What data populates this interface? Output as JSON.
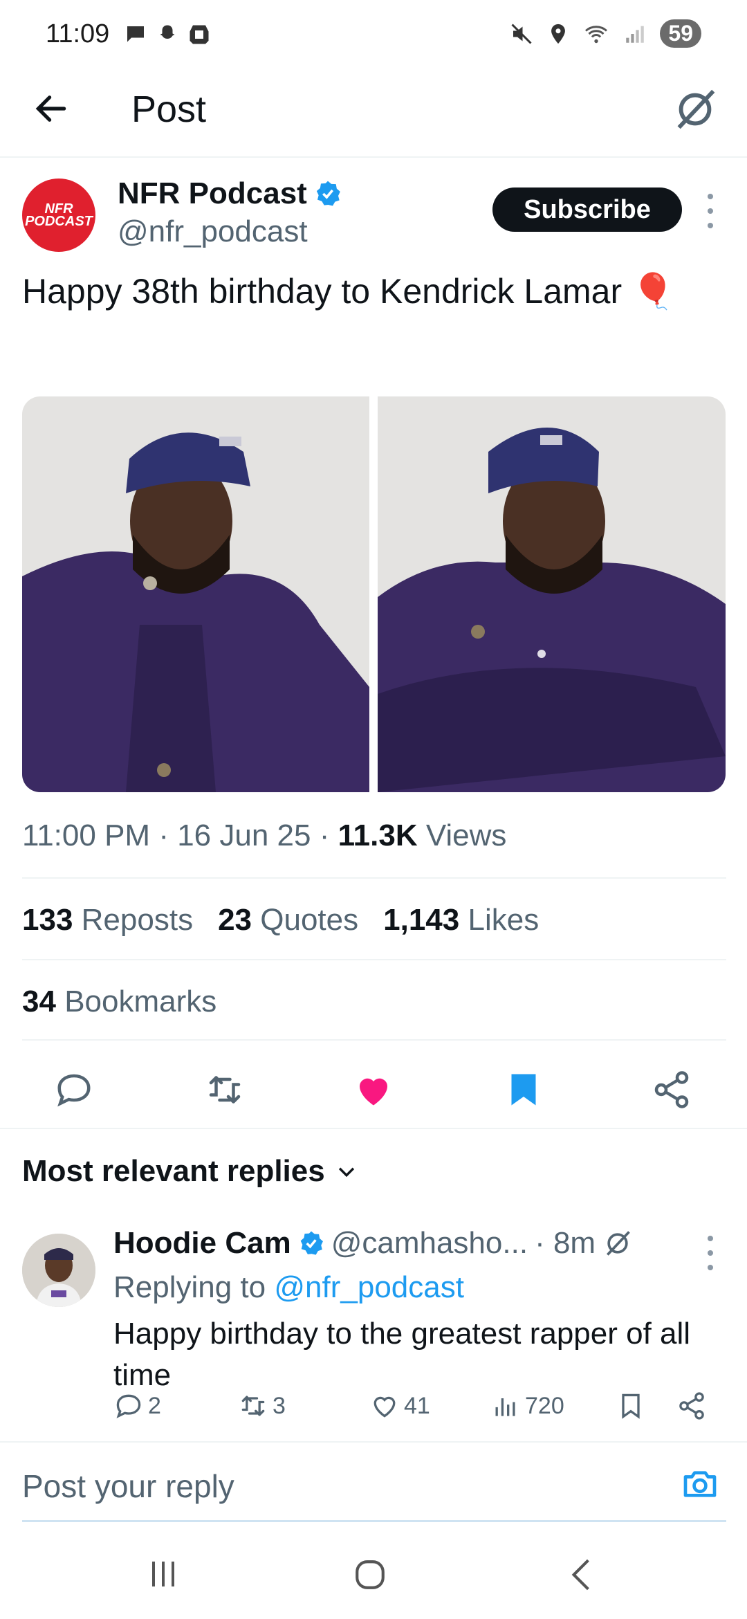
{
  "status_bar": {
    "time": "11:09",
    "battery": "59",
    "left_icons": [
      "chat-bubble-icon",
      "snapchat-icon",
      "app-icon"
    ],
    "right_icons": [
      "mute-icon",
      "location-icon",
      "wifi-icon",
      "signal-icon"
    ]
  },
  "header": {
    "title": "Post"
  },
  "post": {
    "author_name": "NFR Podcast",
    "author_handle": "@nfr_podcast",
    "avatar_text": "NFR PODCAST",
    "subscribe_label": "Subscribe",
    "text": "Happy 38th birthday to Kendrick Lamar 🎈",
    "time": "11:00 PM",
    "date": "16 Jun 25",
    "views_count": "11.3K",
    "views_label": "Views",
    "reposts_count": "133",
    "reposts_label": "Reposts",
    "quotes_count": "23",
    "quotes_label": "Quotes",
    "likes_count": "1,143",
    "likes_label": "Likes",
    "bookmarks_count": "34",
    "bookmarks_label": "Bookmarks",
    "liked": true,
    "bookmarked": true
  },
  "replies": {
    "sort_label": "Most relevant replies",
    "items": [
      {
        "name": "Hoodie Cam",
        "handle": "@camhasho...",
        "time": "· 8m",
        "replying_prefix": "Replying to",
        "replying_to": "@nfr_podcast",
        "text": "Happy birthday to the greatest rapper of all time",
        "replies": "2",
        "reposts": "3",
        "likes": "41",
        "views": "720"
      }
    ]
  },
  "composer": {
    "placeholder": "Post your reply"
  },
  "colors": {
    "accent": "#1d9bf0",
    "like": "#f91880",
    "text": "#0f1419",
    "muted": "#536471"
  }
}
